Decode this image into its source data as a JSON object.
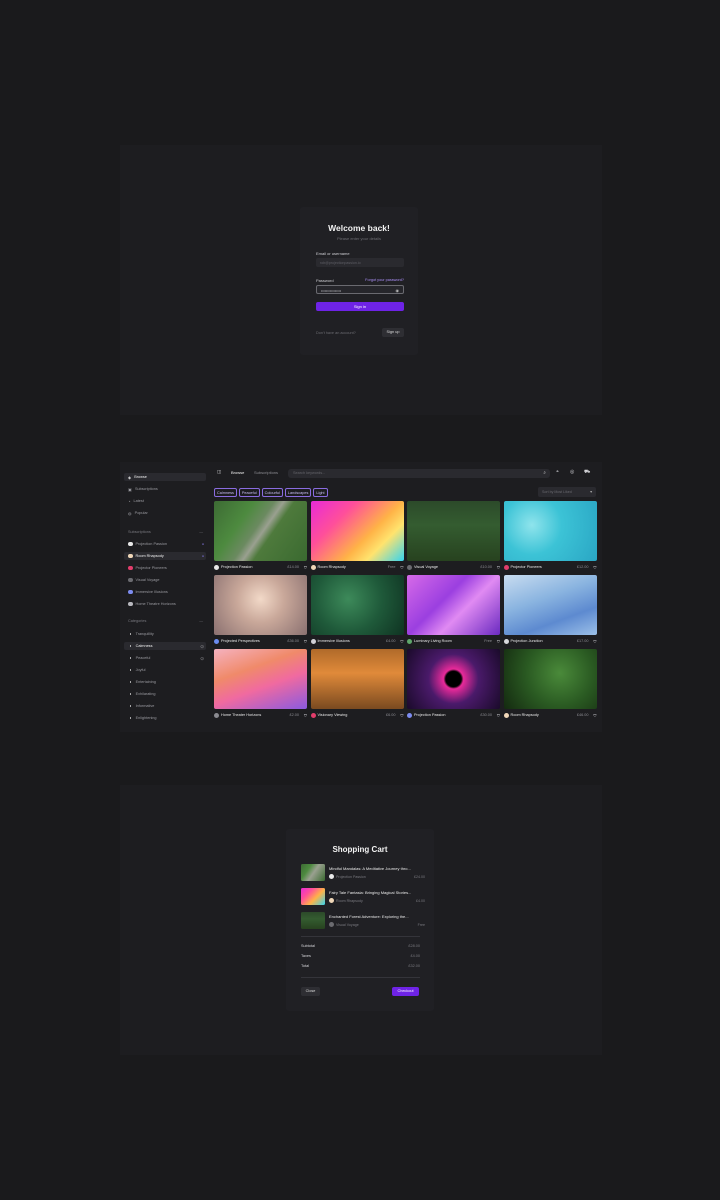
{
  "login": {
    "title": "Welcome back!",
    "subtitle": "Please enter your details",
    "email_label": "Email or username",
    "email_placeholder": "rob@projectionpassion.io",
    "password_label": "Password",
    "forgot_link": "Forgot your password?",
    "password_value": "••••••••••••••••",
    "sign_in": "Sign in",
    "no_account": "Don't have an account?",
    "sign_up": "Sign up"
  },
  "browse": {
    "sidebar": {
      "nav": [
        {
          "label": "Browse",
          "icon": "compass-icon",
          "active": true
        },
        {
          "label": "Subscriptions",
          "icon": "subscriptions-icon",
          "active": false
        },
        {
          "label": "Latest",
          "icon": "clock-icon",
          "active": false
        },
        {
          "label": "Popular",
          "icon": "flame-icon",
          "active": false
        }
      ],
      "subscriptions_header": "Subscriptions",
      "subscriptions": [
        {
          "label": "Projection Passion",
          "color": "#e8e8e8",
          "active": false
        },
        {
          "label": "Room Rhapsody",
          "color": "#f0d7b8",
          "active": true
        },
        {
          "label": "Projector Pioneers",
          "color": "#e23d6b",
          "active": false
        },
        {
          "label": "Visual Voyage",
          "color": "#6b6b70",
          "active": false
        },
        {
          "label": "Immersive Illusions",
          "color": "#7d8cf0",
          "active": false
        },
        {
          "label": "Home Theatre Horizons",
          "color": "#b8b8be",
          "active": false
        }
      ],
      "categories_header": "Categories",
      "categories": [
        {
          "label": "Tranquillity",
          "active": false
        },
        {
          "label": "Calmness",
          "active": true
        },
        {
          "label": "Peaceful",
          "active": false
        },
        {
          "label": "Joyful",
          "active": false
        },
        {
          "label": "Entertaining",
          "active": false
        },
        {
          "label": "Exhilarating",
          "active": false
        },
        {
          "label": "Informative",
          "active": false
        },
        {
          "label": "Enlightening",
          "active": false
        }
      ]
    },
    "tabs": [
      {
        "label": "Browse",
        "active": true
      },
      {
        "label": "Subscriptions",
        "active": false
      }
    ],
    "search_placeholder": "Search keywords...",
    "chips": [
      "Calmness",
      "Peaceful",
      "Colourful",
      "Landscapes",
      "Light"
    ],
    "sort_label": "Sort by Most Liked",
    "cards": [
      {
        "name": "Projection Passion",
        "price": "£14.00",
        "avatar": "#e8e8e8"
      },
      {
        "name": "Room Rhapsody",
        "price": "Free",
        "avatar": "#f0d7b8"
      },
      {
        "name": "Visual Voyage",
        "price": "£10.00",
        "avatar": "#6b6b70"
      },
      {
        "name": "Projector Pioneers",
        "price": "£12.00",
        "avatar": "#e23d6b"
      },
      {
        "name": "Projected Perspectives",
        "price": "£36.00",
        "avatar": "#6b8cf0"
      },
      {
        "name": "Immersive Illusions",
        "price": "£4.00",
        "avatar": "#d0d0d6"
      },
      {
        "name": "Luminary Living Room",
        "price": "Free",
        "avatar": "#5fa86b"
      },
      {
        "name": "Projection Junction",
        "price": "£17.00",
        "avatar": "#d8d8dc"
      },
      {
        "name": "Home Theater Horizons",
        "price": "£2.00",
        "avatar": "#8a8a90"
      },
      {
        "name": "Visionary Viewing",
        "price": "£6.00",
        "avatar": "#e23d6b"
      },
      {
        "name": "Projection Passion",
        "price": "£30.00",
        "avatar": "#7d8cf0"
      },
      {
        "name": "Room Rhapsody",
        "price": "£46.00",
        "avatar": "#f0d7b8"
      }
    ]
  },
  "cart": {
    "title": "Shopping Cart",
    "items": [
      {
        "title": "Mindful Mandalas: A Meditative Journey thro...",
        "seller": "Projection Passion",
        "price": "£24.00",
        "avatar": "#e8e8e8"
      },
      {
        "title": "Fairy Tale Fantasia: Bringing Magical Stories...",
        "seller": "Room Rhapsody",
        "price": "£4.00",
        "avatar": "#f0d7b8"
      },
      {
        "title": "Enchanted Forest Adventure: Exploring the...",
        "seller": "Visual Voyage",
        "price": "Free",
        "avatar": "#6b6b70"
      }
    ],
    "subtotal_label": "Subtotal",
    "subtotal": "£28.00",
    "taxes_label": "Taxes",
    "taxes": "£4.00",
    "total_label": "Total",
    "total": "£32.00",
    "close": "Close",
    "checkout": "Checkout"
  }
}
